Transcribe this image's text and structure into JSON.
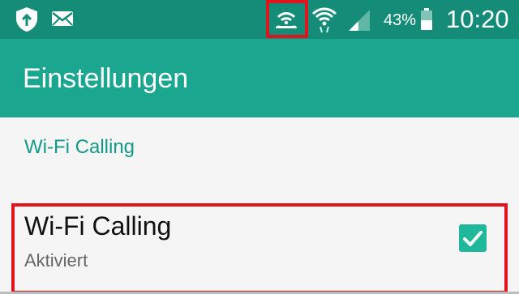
{
  "status_bar": {
    "battery_percent": "43%",
    "time": "10:20",
    "icons": [
      "shield-app-icon",
      "mail-icon",
      "wifi-calling-icon",
      "wifi-icon",
      "cellular-signal-icon",
      "battery-icon"
    ]
  },
  "app_bar": {
    "title": "Einstellungen"
  },
  "section": {
    "header": "Wi-Fi Calling"
  },
  "setting": {
    "title": "Wi-Fi Calling",
    "summary": "Aktiviert",
    "checked": true,
    "accent": "#1fb89a"
  },
  "colors": {
    "status_bar": "#148c78",
    "app_bar": "#1aa68f",
    "highlight": "#e0141c",
    "section_text": "#159a85"
  }
}
